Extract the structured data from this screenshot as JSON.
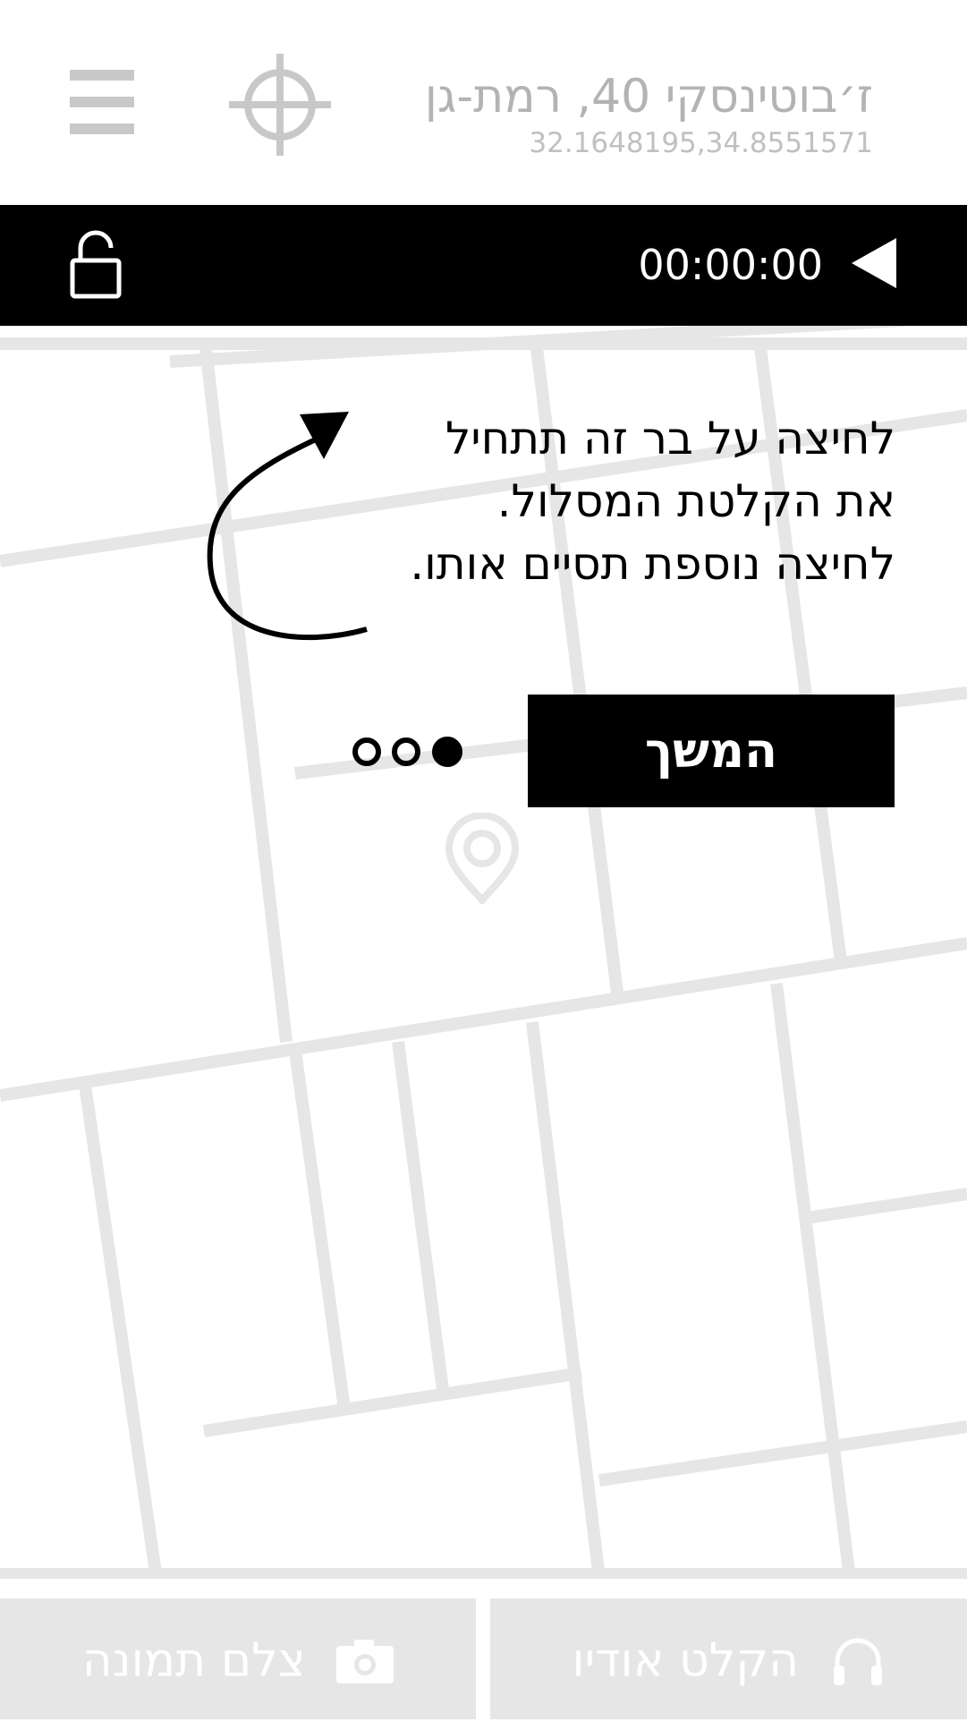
{
  "header": {
    "address": "ז׳בוטינסקי 40, רמת-גן",
    "coordinates": "32.1648195,34.8551571",
    "menu_icon": "hamburger-menu-icon",
    "locate_icon": "crosshair-icon"
  },
  "record_bar": {
    "timer": "00:00:00",
    "lock_icon": "unlocked-padlock-icon",
    "play_icon": "play-left-triangle-icon"
  },
  "hint": {
    "line1": "לחיצה על בר זה תתחיל",
    "line2": "את הקלטת המסלול.",
    "line3": "לחיצה נוספת תסיים אותו."
  },
  "pagination": {
    "total": 3,
    "active_index": 2
  },
  "continue_button": {
    "label": "המשך"
  },
  "bottom_actions": {
    "record_audio": "הקלט אודיו",
    "take_photo": "צלם תמונה"
  },
  "colors": {
    "bar": "#000000",
    "map_roads": "#e6e6e6",
    "header_text": "#b3b3b3",
    "bottom_buttons": "#e6e6e6"
  }
}
